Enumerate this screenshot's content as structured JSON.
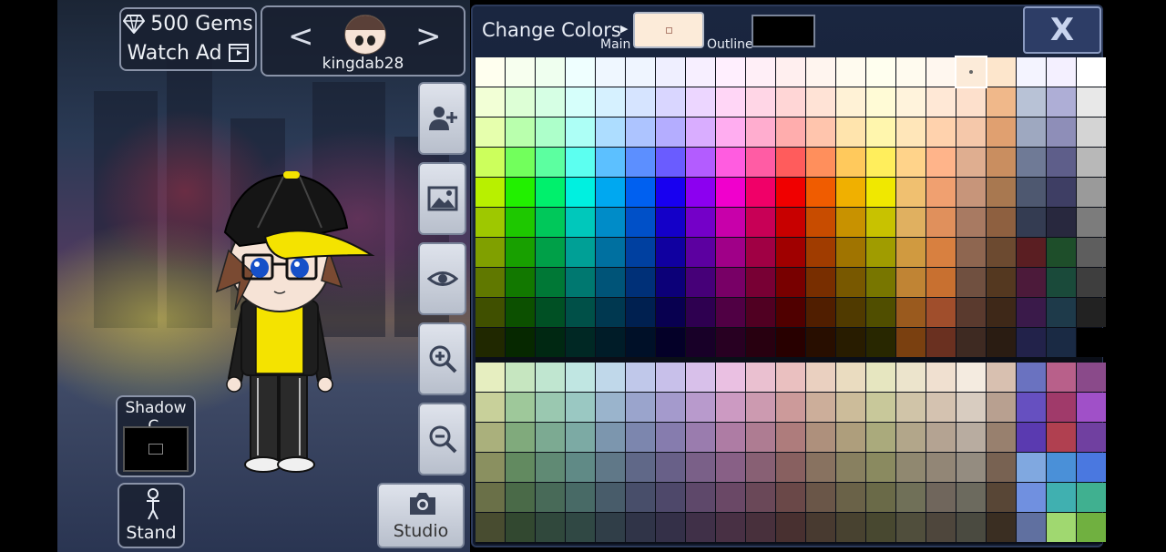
{
  "currency": {
    "gems_label": "500 Gems",
    "watch_ad_label": "Watch Ad"
  },
  "character": {
    "name": "kingdab28",
    "prev_arrow": "<",
    "next_arrow": ">"
  },
  "tools": [
    {
      "name": "add-character-button",
      "icon": "person-add-icon"
    },
    {
      "name": "background-button",
      "icon": "image-icon"
    },
    {
      "name": "visibility-button",
      "icon": "eye-icon"
    },
    {
      "name": "zoom-in-button",
      "icon": "zoom-in-icon"
    },
    {
      "name": "zoom-out-button",
      "icon": "zoom-out-icon"
    }
  ],
  "shadow": {
    "label": "Shadow C."
  },
  "stand": {
    "label": "Stand"
  },
  "studio": {
    "label": "Studio"
  },
  "color_panel": {
    "title": "Change Colors",
    "main_label": "Main",
    "outline_label": "Outline",
    "main_color": "#fcebd9",
    "outline_color": "#000000",
    "close_label": "X",
    "selected_cell": [
      0,
      16
    ],
    "palette_top": [
      [
        "#ffffef",
        "#f7ffef",
        "#efffef",
        "#efffff",
        "#eff7ff",
        "#eff5ff",
        "#efefff",
        "#f7efff",
        "#ffeffe",
        "#ffeff7",
        "#ffefef",
        "#fff5ef",
        "#fffbef",
        "#ffffef",
        "#fffbef",
        "#fff7ef",
        "#fcebd9",
        "#fde6cc",
        "#f4f4ff",
        "#f4f0ff",
        "#ffffff"
      ],
      [
        "#f2ffd6",
        "#ddffd6",
        "#d6ffe4",
        "#d6fffb",
        "#d6f1ff",
        "#d6e4ff",
        "#d9d6ff",
        "#ecd6ff",
        "#ffd6f6",
        "#ffd6e6",
        "#ffd6d6",
        "#ffe3d6",
        "#fff2d6",
        "#fffbd6",
        "#fff3dc",
        "#ffe8d6",
        "#fde0cc",
        "#f0b88a",
        "#b8c2d6",
        "#aeaed6",
        "#e8e8e8"
      ],
      [
        "#e6ffad",
        "#b9ffad",
        "#adffca",
        "#adfff6",
        "#adddff",
        "#adc4ff",
        "#b4adff",
        "#d9adff",
        "#ffadf0",
        "#ffadcf",
        "#ffadad",
        "#ffc5ad",
        "#ffe4ad",
        "#fff6ad",
        "#ffe6b9",
        "#ffd2ad",
        "#f5c8aa",
        "#e0a070",
        "#9ea8c0",
        "#8e8eb8",
        "#d4d4d4"
      ],
      [
        "#ccff5c",
        "#72ff5c",
        "#5cffa0",
        "#5cfff0",
        "#5cc0ff",
        "#5c8fff",
        "#6a5cff",
        "#b35cff",
        "#ff5ce0",
        "#ff5ca4",
        "#ff5c5c",
        "#ff8f5c",
        "#ffc95c",
        "#ffee5c",
        "#ffd38a",
        "#ffb48a",
        "#dfae90",
        "#c98e60",
        "#6f7a96",
        "#5e5e8a",
        "#b8b8b8"
      ],
      [
        "#b8f000",
        "#22f000",
        "#00f06c",
        "#00f0e0",
        "#00a8f0",
        "#0060f0",
        "#1800f0",
        "#8c00f0",
        "#f000cc",
        "#f00068",
        "#f00000",
        "#f05c00",
        "#f0b000",
        "#f0e800",
        "#f0c070",
        "#f0a070",
        "#c7957a",
        "#a87850",
        "#4e5870",
        "#3e3e64",
        "#9a9a9a"
      ],
      [
        "#9ec800",
        "#1ec800",
        "#00c85a",
        "#00c8bb",
        "#008cc8",
        "#0050c8",
        "#1400c8",
        "#7400c8",
        "#c800aa",
        "#c80056",
        "#c80000",
        "#c84c00",
        "#c89200",
        "#c8c200",
        "#e0b060",
        "#e0905c",
        "#a87a62",
        "#8e6040",
        "#343c52",
        "#28283e",
        "#7c7c7c"
      ],
      [
        "#80a000",
        "#18a000",
        "#00a048",
        "#00a096",
        "#0070a0",
        "#0040a0",
        "#1000a0",
        "#5c00a0",
        "#a00088",
        "#a00044",
        "#a00000",
        "#a03c00",
        "#a07400",
        "#a09c00",
        "#d09a40",
        "#d88040",
        "#8e6650",
        "#6c4a30",
        "#5a1e22",
        "#1e4e2a",
        "#5e5e5e"
      ],
      [
        "#607800",
        "#127800",
        "#007836",
        "#007870",
        "#005478",
        "#003078",
        "#0c0078",
        "#460078",
        "#780066",
        "#780034",
        "#780000",
        "#782e00",
        "#785800",
        "#787600",
        "#c08434",
        "#c87030",
        "#705040",
        "#543820",
        "#4c1a3a",
        "#1a4a3a",
        "#3e3e3e"
      ],
      [
        "#405000",
        "#0c5000",
        "#005024",
        "#005048",
        "#003850",
        "#002050",
        "#080050",
        "#2e0050",
        "#500044",
        "#500022",
        "#500000",
        "#501e00",
        "#503a00",
        "#504e00",
        "#9a5a1e",
        "#a04e2c",
        "#5a3a2e",
        "#3e2818",
        "#3a1a4a",
        "#1e3a4a",
        "#222222"
      ],
      [
        "#202800",
        "#062800",
        "#002812",
        "#002824",
        "#001c28",
        "#001028",
        "#040028",
        "#180028",
        "#280022",
        "#280010",
        "#280000",
        "#280e00",
        "#281c00",
        "#282700",
        "#7a4010",
        "#6a3020",
        "#3e2a22",
        "#2a1c12",
        "#22224a",
        "#1a2a44",
        "#000000"
      ]
    ],
    "palette_bottom": [
      [
        "#e6eec0",
        "#c6e6c0",
        "#c0e6d0",
        "#c0e6e2",
        "#c0d8ea",
        "#c0c8ea",
        "#c8c0ea",
        "#d8c0ea",
        "#eac0e2",
        "#eac0d0",
        "#eac0c0",
        "#ead0c0",
        "#eadcc0",
        "#e6e6c0",
        "#ece4cc",
        "#f0e0d0",
        "#f4ebe0",
        "#d8c0b0",
        "#6a72c0",
        "#b8608a",
        "#8a4a8a"
      ],
      [
        "#c8d09a",
        "#9ec89a",
        "#9ac8b0",
        "#9ac8c2",
        "#9ab4cc",
        "#9aa4cc",
        "#a49acc",
        "#b89acc",
        "#cc9ac2",
        "#cc9ab0",
        "#cc9a9a",
        "#ccae9a",
        "#ccbc9a",
        "#c8c89a",
        "#d0c4a8",
        "#d4c2b0",
        "#d8ccc0",
        "#b8a090",
        "#6650c0",
        "#a03a6a",
        "#a050c8"
      ],
      [
        "#aab07c",
        "#80aa7c",
        "#7caa92",
        "#7caaa4",
        "#7c96ae",
        "#7c86ae",
        "#867cae",
        "#9a7cae",
        "#ae7ca4",
        "#ae7c92",
        "#ae7c7c",
        "#ae907c",
        "#ae9e7c",
        "#aaaa7c",
        "#b2a68a",
        "#b4a392",
        "#b8aca0",
        "#98806e",
        "#5a3ab0",
        "#b04050",
        "#7040a0"
      ],
      [
        "#8a9060",
        "#628a60",
        "#608a74",
        "#608a86",
        "#607888",
        "#606888",
        "#686088",
        "#7a6088",
        "#886086",
        "#886074",
        "#886060",
        "#887260",
        "#888060",
        "#8a8a60",
        "#908870",
        "#928676",
        "#948c80",
        "#786252",
        "#80a8e0",
        "#4a90d8",
        "#4a78e0"
      ],
      [
        "#6a7048",
        "#4a6a48",
        "#486a58",
        "#486a66",
        "#485c6a",
        "#484e6a",
        "#4e486a",
        "#5e486a",
        "#6a4866",
        "#6a4858",
        "#6a4848",
        "#6a5648",
        "#6a6248",
        "#6a6a48",
        "#707058",
        "#70665c",
        "#6c6a5e",
        "#584636",
        "#7090e0",
        "#40b0b0",
        "#40b090"
      ],
      [
        "#484c30",
        "#324830",
        "#30483c",
        "#304844",
        "#303e48",
        "#303448",
        "#343048",
        "#403048",
        "#483044",
        "#48303c",
        "#483030",
        "#483a30",
        "#484230",
        "#484830",
        "#504e3c",
        "#4e463c",
        "#4a4a40",
        "#3a2e22",
        "#6070a0",
        "#a0d870",
        "#70b040"
      ]
    ]
  }
}
